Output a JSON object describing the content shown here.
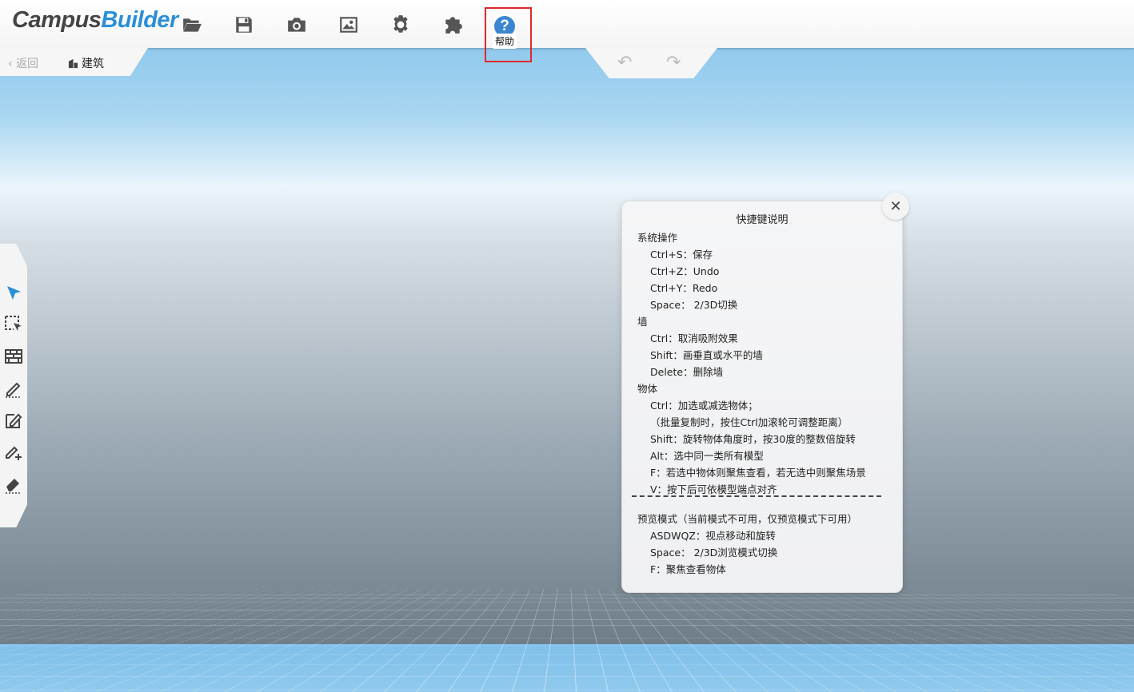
{
  "app": {
    "logo_part1": "Campus",
    "logo_part2": "Builder"
  },
  "toolbar": {
    "tools": [
      "open-folder-icon",
      "save-icon",
      "camera-icon",
      "image-icon",
      "settings-gear-icon",
      "plugin-puzzle-icon"
    ],
    "help_symbol": "?",
    "help_tooltip": "帮助"
  },
  "subbar": {
    "back_label": "返回",
    "back_arrow": "‹",
    "building_label": "建筑"
  },
  "history": {
    "undo_symbol": "↶",
    "redo_symbol": "↷"
  },
  "left_tools": [
    "select-arrow-icon",
    "box-select-icon",
    "wall-brick-icon",
    "draw-pen-icon",
    "edit-area-icon",
    "add-pen-icon",
    "eraser-icon"
  ],
  "dialog": {
    "close_symbol": "✕",
    "title": "快捷键说明",
    "lines": [
      "系统操作",
      "Ctrl+S：保存",
      "Ctrl+Z：Undo",
      "Ctrl+Y：Redo",
      "Space： 2/3D切换",
      "墙",
      "Ctrl：取消吸附效果",
      "Shift：画垂直或水平的墙",
      "Delete：删除墙",
      "物体",
      "Ctrl：加选或减选物体；",
      "（批量复制时，按住Ctrl加滚轮可调整距离）",
      "Shift：旋转物体角度时，按30度的整数倍旋转",
      "Alt：选中同一类所有模型",
      "F：若选中物体则聚焦查看，若无选中则聚焦场景",
      "V：按下后可依模型端点对齐",
      "预览模式（当前模式不可用，仅预览模式下可用）",
      "ASDWQZ：视点移动和旋转",
      "Space： 2/3D浏览模式切换",
      "F：聚焦查看物体"
    ]
  }
}
